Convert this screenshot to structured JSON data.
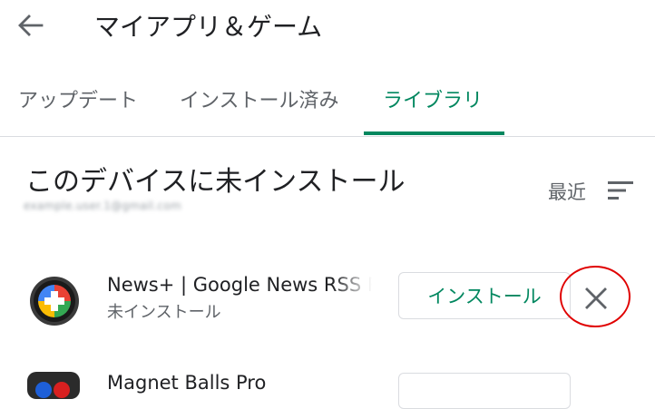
{
  "header": {
    "title": "マイアプリ＆ゲーム",
    "back_icon": "arrow-back-icon"
  },
  "tabs": [
    {
      "label": "アップデート",
      "active": false
    },
    {
      "label": "インストール済み",
      "active": false
    },
    {
      "label": "ライブラリ",
      "active": true
    }
  ],
  "section": {
    "title": "このデバイスに未インストール",
    "account": "example.user.1@gmail.com",
    "sort_label": "最近",
    "sort_icon": "sort-icon"
  },
  "apps": [
    {
      "name": "News+ | Google News RSS Reader",
      "status": "未インストール",
      "install_label": "インストール",
      "remove_icon": "close-icon"
    },
    {
      "name": "Magnet Balls Pro",
      "install_label": ""
    }
  ],
  "colors": {
    "accent": "#01875f",
    "text_primary": "#202124",
    "text_secondary": "#5f6368",
    "divider": "#dadce0",
    "highlight": "#e00000"
  }
}
